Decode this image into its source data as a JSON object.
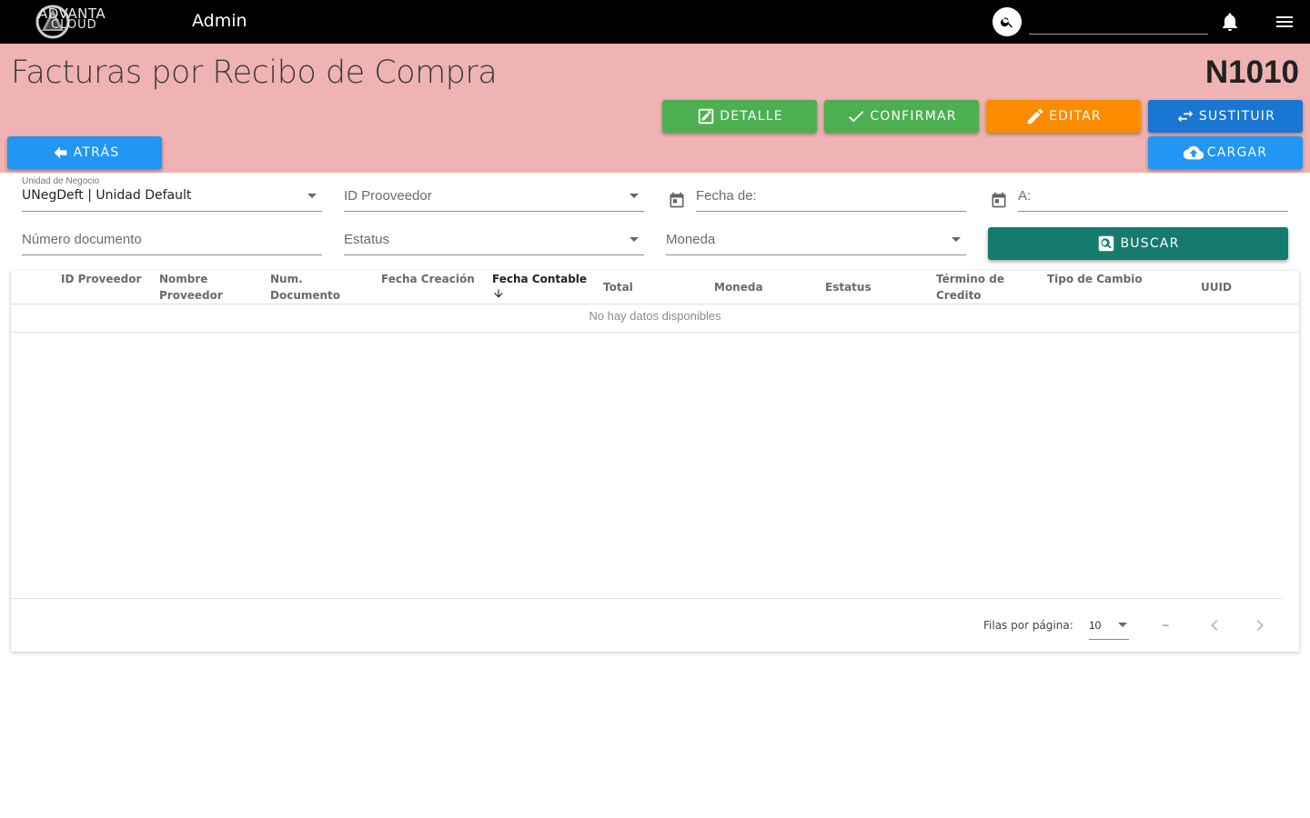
{
  "appbar": {
    "logo_line1": "ADVANTA",
    "logo_line2": "CLOUD",
    "title": "Admin",
    "search_value": "",
    "icons": [
      "search-icon",
      "bell-icon",
      "menu-icon"
    ]
  },
  "header": {
    "page_title": "Facturas por Recibo de Compra",
    "code": "N1010",
    "buttons": {
      "detalle": "DETALLE",
      "confirmar": "CONFIRMAR",
      "editar": "EDITAR",
      "sustituir": "SUSTITUIR",
      "atras": "ATRÁS",
      "cargar": "CARGAR"
    }
  },
  "filters": {
    "unidad_negocio_label": "Unidad de Negocio",
    "unidad_negocio_value": "UNegDeft | Unidad Default",
    "id_proveedor_label": "ID Prooveedor",
    "fecha_de_label": "Fecha de:",
    "fecha_a_label": "A:",
    "numero_documento_label": "Número documento",
    "estatus_label": "Estatus",
    "moneda_label": "Moneda",
    "buscar_label": "BUSCAR"
  },
  "table": {
    "columns": [
      [
        "ID Proveedor"
      ],
      [
        "Nombre",
        "Proveedor"
      ],
      [
        "Num.",
        "Documento"
      ],
      [
        "Fecha Creación"
      ],
      [
        "Fecha Contable"
      ],
      [
        "Total"
      ],
      [
        "Moneda"
      ],
      [
        "Estatus"
      ],
      [
        "Término de",
        "Credito"
      ],
      [
        "Tipo de Cambio"
      ],
      [
        "UUID"
      ]
    ],
    "no_data": "No hay datos disponibles",
    "rows_per_page_label": "Filas por página:",
    "rows_per_page_value": "10",
    "range_text": "–"
  },
  "colors": {
    "header_bg": "#efb3b3",
    "green": "#4caf50",
    "orange": "#fb8c00",
    "blue_dark": "#1976d2",
    "blue": "#2196f3",
    "teal": "#147b6e"
  }
}
